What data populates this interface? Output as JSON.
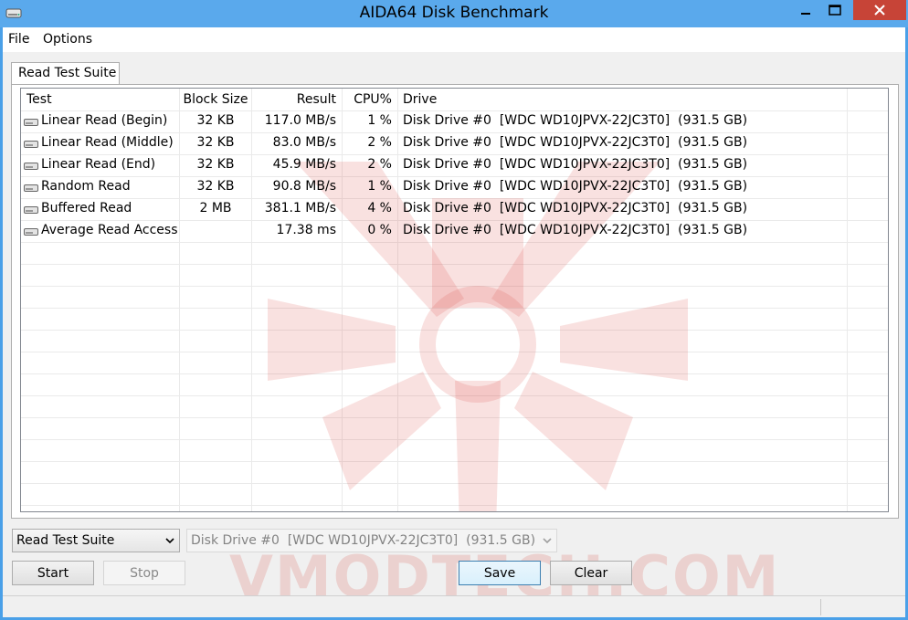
{
  "window": {
    "title": "AIDA64 Disk Benchmark"
  },
  "menu": {
    "file": "File",
    "options": "Options"
  },
  "tab": {
    "label": "Read Test Suite"
  },
  "table": {
    "headers": {
      "test": "Test",
      "block_size": "Block Size",
      "result": "Result",
      "cpu": "CPU%",
      "drive": "Drive"
    },
    "rows": [
      {
        "test": "Linear Read (Begin)",
        "block_size": "32 KB",
        "result": "117.0 MB/s",
        "cpu": "1 %",
        "drive": "Disk Drive #0  [WDC WD10JPVX-22JC3T0]  (931.5 GB)"
      },
      {
        "test": "Linear Read (Middle)",
        "block_size": "32 KB",
        "result": "83.0 MB/s",
        "cpu": "2 %",
        "drive": "Disk Drive #0  [WDC WD10JPVX-22JC3T0]  (931.5 GB)"
      },
      {
        "test": "Linear Read (End)",
        "block_size": "32 KB",
        "result": "45.9 MB/s",
        "cpu": "2 %",
        "drive": "Disk Drive #0  [WDC WD10JPVX-22JC3T0]  (931.5 GB)"
      },
      {
        "test": "Random Read",
        "block_size": "32 KB",
        "result": "90.8 MB/s",
        "cpu": "1 %",
        "drive": "Disk Drive #0  [WDC WD10JPVX-22JC3T0]  (931.5 GB)"
      },
      {
        "test": "Buffered Read",
        "block_size": "2 MB",
        "result": "381.1 MB/s",
        "cpu": "4 %",
        "drive": "Disk Drive #0  [WDC WD10JPVX-22JC3T0]  (931.5 GB)"
      },
      {
        "test": "Average Read Access",
        "block_size": "",
        "result": "17.38 ms",
        "cpu": "0 %",
        "drive": "Disk Drive #0  [WDC WD10JPVX-22JC3T0]  (931.5 GB)"
      }
    ]
  },
  "controls": {
    "suite_select": "Read Test Suite",
    "drive_select": "Disk Drive #0  [WDC WD10JPVX-22JC3T0]  (931.5 GB)",
    "start": "Start",
    "stop": "Stop",
    "save": "Save",
    "clear": "Clear"
  },
  "watermark": {
    "text": "VMODTECH.COM"
  },
  "icons": {
    "app": "disk-icon",
    "row": "disk-drive-icon",
    "minimize": "minimize-icon",
    "maximize": "maximize-icon",
    "close": "close-icon",
    "dropdown": "chevron-down-icon"
  },
  "colors": {
    "titlebar": "#5aa9ec",
    "close_button": "#c74437",
    "watermark": "#d7463c"
  }
}
